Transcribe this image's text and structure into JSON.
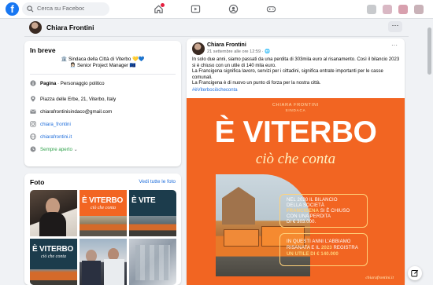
{
  "header": {
    "search_placeholder": "Cerca su Facebook"
  },
  "profile": {
    "name": "Chiara Frontini",
    "more_label": "···"
  },
  "intro": {
    "title": "In breve",
    "bio_line1": "🏛️ Sindaca della Città di Viterbo 💛💙",
    "bio_line2": "👩🏻‍💼 Senior Project Manager 🇪🇺",
    "page_label": "Pagina",
    "page_category": " · Personaggio politico",
    "address": "Piazza delle Erbe, 21, Viterbo, Italy",
    "email": "chiarafrontinisindaco@gmail.com",
    "instagram": "chiara_frontini",
    "website": "chiarafrontini.it",
    "hours": "Sempre aperto"
  },
  "photos": {
    "title": "Foto",
    "see_all": "Vedi tutte le foto",
    "tile_text1": "È VITERBO",
    "tile_text2": "ciò che conta",
    "tile_text_short": "È VITE"
  },
  "post": {
    "author": "Chiara Frontini",
    "date": "21 settembre alle ore 12:59 · 🌐",
    "more": "···",
    "text_line1": "In solo due anni, siamo passati da una perdita di 303mila euro al risanamento. Così il bilancio 2023 si è chiuso con un utile di 140 mila euro.",
    "text_line2": "La Francigena significa lavoro, servizi per i cittadini, significa entrate importanti per le casse comunali.",
    "text_line3": "La Francigena è di nuovo un punto di forza per la nostra città.",
    "hashtag": "#èViterbociòcheconta",
    "image": {
      "name": "CHIARA FRONTINI",
      "role": "SINDACA",
      "headline": "È VITERBO",
      "subheadline": "ciò che conta",
      "block1_l1": "NEL 2020 IL BILANCIO",
      "block1_l2": "DELLA SOCIETÀ",
      "block1_l3_hl": "FRANCIGENA",
      "block1_l3": " SI È CHIUSO",
      "block1_l4": "CON UNA PERDITA",
      "block1_l5": "DI € 303.000.",
      "block2_l1": "IN QUESTI ANNI L'ABBIAMO",
      "block2_l2": "RISANATA E IL ",
      "block2_l2_hl": "2023",
      "block2_l2_end": " REGISTRA",
      "block2_l3_hl": "UN UTILE DI € 140.000",
      "signature": "chiarafrontini.it"
    }
  },
  "colors": {
    "facebook_blue": "#1877f2",
    "link_blue": "#216fdb",
    "brand_orange": "#f26522",
    "highlight_yellow": "#ffd27a",
    "open_green": "#31a24c"
  }
}
